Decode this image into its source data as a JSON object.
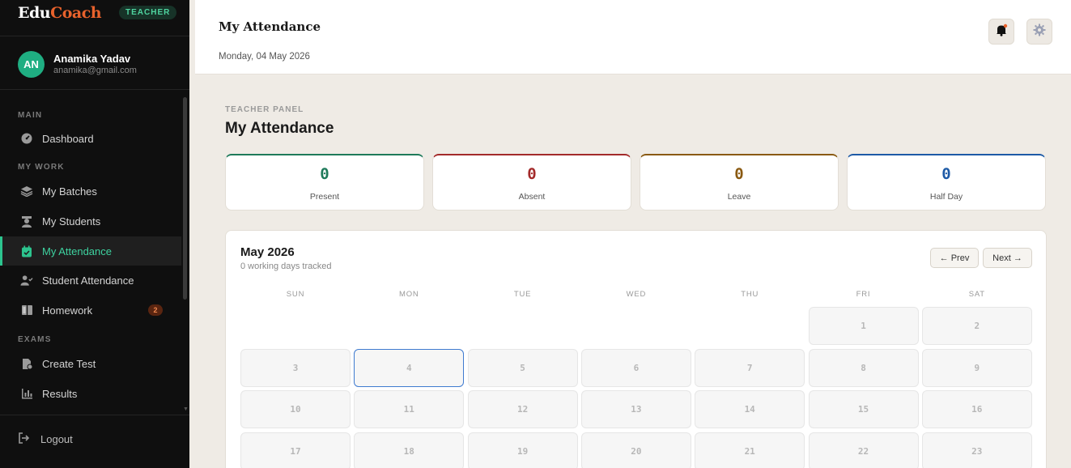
{
  "brand": {
    "part1": "Edu",
    "part2": "Coach",
    "role": "TEACHER"
  },
  "user": {
    "initials": "AN",
    "name": "Anamika Yadav",
    "email": "anamika@gmail.com"
  },
  "sidebar": {
    "sections": {
      "main": "MAIN",
      "work": "MY WORK",
      "exams": "EXAMS"
    },
    "items": [
      {
        "label": "Dashboard",
        "icon": "dashboard-icon"
      },
      {
        "label": "My Batches",
        "icon": "layers-icon"
      },
      {
        "label": "My Students",
        "icon": "students-icon"
      },
      {
        "label": "My Attendance",
        "icon": "calendar-check-icon",
        "active": true
      },
      {
        "label": "Student Attendance",
        "icon": "user-check-icon"
      },
      {
        "label": "Homework",
        "icon": "book-icon",
        "count": "2"
      },
      {
        "label": "Create Test",
        "icon": "file-edit-icon"
      },
      {
        "label": "Results",
        "icon": "bar-chart-icon"
      }
    ],
    "logout": "Logout"
  },
  "topbar": {
    "title": "My Attendance",
    "date": "Monday, 04 May 2026"
  },
  "main": {
    "panel_label": "TEACHER PANEL",
    "title": "My Attendance",
    "stats": [
      {
        "value": "0",
        "label": "Present",
        "color": "#1e7a5a"
      },
      {
        "value": "0",
        "label": "Absent",
        "color": "#a32a2a"
      },
      {
        "value": "0",
        "label": "Leave",
        "color": "#8a5a12"
      },
      {
        "value": "0",
        "label": "Half Day",
        "color": "#1d5aa6"
      }
    ],
    "calendar": {
      "month": "May 2026",
      "subtitle": "0 working days tracked",
      "prev": "← Prev",
      "next": "Next →",
      "weekdays": [
        "SUN",
        "MON",
        "TUE",
        "WED",
        "THU",
        "FRI",
        "SAT"
      ],
      "first_weekday_index": 5,
      "days": [
        "1",
        "2",
        "3",
        "4",
        "5",
        "6",
        "7",
        "8",
        "9",
        "10",
        "11",
        "12",
        "13",
        "14",
        "15",
        "16",
        "17",
        "18",
        "19",
        "20",
        "21",
        "22",
        "23"
      ],
      "today": "4"
    }
  },
  "colors": {
    "accent": "#2cc48e",
    "brand_orange": "#e8622c",
    "notification_dot": "#e8622c"
  }
}
